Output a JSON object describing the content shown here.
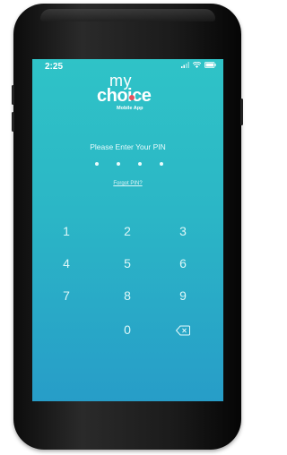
{
  "status_bar": {
    "time": "2:25",
    "icons": [
      "signal-icon",
      "wifi-icon",
      "battery-icon"
    ]
  },
  "logo": {
    "line1": "my",
    "line2": "choice",
    "subtitle": "Mobile App"
  },
  "pin_screen": {
    "prompt": "Please Enter Your PIN",
    "pin_length": 4,
    "digits_entered": 0,
    "forgot_link": "Forgot PIN?"
  },
  "keypad": {
    "k1": "1",
    "k2": "2",
    "k3": "3",
    "k4": "4",
    "k5": "5",
    "k6": "6",
    "k7": "7",
    "k8": "8",
    "k9": "9",
    "k0": "0",
    "delete_icon": "backspace-icon"
  },
  "colors": {
    "screen_top": "#2fc3c7",
    "screen_bottom": "#279dc8",
    "logo_accent": "#e35160",
    "phone_body": "#1b1b1b"
  }
}
